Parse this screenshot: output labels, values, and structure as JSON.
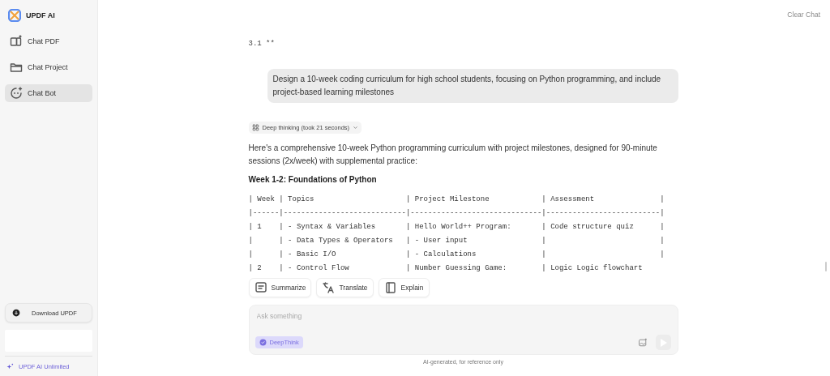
{
  "app": {
    "name": "UPDF AI"
  },
  "sidebar": {
    "items": [
      {
        "label": "Chat PDF",
        "selected": false
      },
      {
        "label": "Chat Project",
        "selected": false
      },
      {
        "label": "Chat Bot",
        "selected": true
      }
    ],
    "download_button": "Download UPDF",
    "plan_link": "UPDF AI Unlimited"
  },
  "header": {
    "clear_button": "Clear Chat"
  },
  "chat": {
    "previous_tail": "3.1 **",
    "user_message": "Design a 10-week coding curriculum for high school students, focusing on Python programming, and include project-based learning milestones",
    "thinking": {
      "label": "Deep thinking (took 21 seconds)"
    },
    "answer_intro": "Here's a comprehensive 10-week Python programming curriculum with project milestones, designed for 90-minute sessions (2x/week) with supplemental practice:",
    "section_heading": "Week 1-2: Foundations of Python",
    "table_lines": [
      "| Week | Topics                     | Project Milestone            | Assessment               |",
      "|------|----------------------------|------------------------------|--------------------------|",
      "| 1    | - Syntax & Variables       | Hello World++ Program:       | Code structure quiz      |",
      "|      | - Data Types & Operators   | - User input                 |                          |",
      "|      | - Basic I/O                | - Calculations               |                          |",
      "| 2    | - Control Flow             | Number Guessing Game:        | Logic Logic flowchart"
    ],
    "actions": [
      {
        "label": "Summarize"
      },
      {
        "label": "Translate"
      },
      {
        "label": "Explain"
      }
    ]
  },
  "composer": {
    "placeholder": "Ask something",
    "deepthink": {
      "label": "DeepThink",
      "on": true
    }
  },
  "disclaimer": "AI-generated, for reference only"
}
